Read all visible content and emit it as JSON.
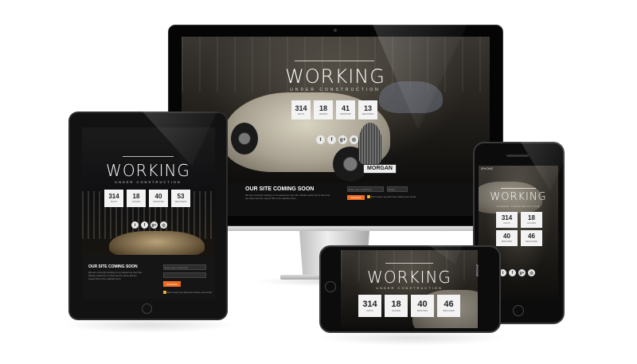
{
  "site": {
    "title": "WORKING",
    "subtitle": "UNDER CONSTRUCTION",
    "plate": "MORGAN"
  },
  "imac": {
    "countdown": [
      {
        "value": "314",
        "label": "DAYS"
      },
      {
        "value": "18",
        "label": "HOURS"
      },
      {
        "value": "41",
        "label": "MINUTES"
      },
      {
        "value": "13",
        "label": "SECONDS"
      }
    ],
    "coming_soon": "OUR SITE COMING SOON",
    "description": "We are currently working on an awesome new site. Please stand by! In short we are done and we expect this to be realized soon.",
    "email_placeholder": "Enter your email here",
    "name_placeholder": "Name",
    "subscribe": "Subscribe",
    "notice": "Don't worry we will never share your email"
  },
  "ipad": {
    "countdown": [
      {
        "value": "314",
        "label": "DAYS"
      },
      {
        "value": "18",
        "label": "HOURS"
      },
      {
        "value": "40",
        "label": "MINUTES"
      },
      {
        "value": "53",
        "label": "SECONDS"
      }
    ],
    "coming_soon": "OUR SITE COMING SOON",
    "description": "We are currently working on an awesome new site. Please stand by! In short we are done and we expect this to be realized soon.",
    "email_placeholder": "Enter your email here",
    "subscribe": "Subscribe",
    "notice": "Don't worry we will never share your email"
  },
  "iphone_portrait": {
    "carrier": "iPHONE",
    "countdown": [
      {
        "value": "314",
        "label": "DAYS"
      },
      {
        "value": "18",
        "label": "HOURS"
      },
      {
        "value": "40",
        "label": "MINUTES"
      },
      {
        "value": "46",
        "label": "SECONDS"
      }
    ]
  },
  "iphone_landscape": {
    "carrier": "iPHONE",
    "countdown": [
      {
        "value": "314",
        "label": "DAYS"
      },
      {
        "value": "18",
        "label": "HOURS"
      },
      {
        "value": "40",
        "label": "MINUTES"
      },
      {
        "value": "46",
        "label": "SECONDS"
      }
    ]
  },
  "social_icons": [
    "twitter-icon",
    "facebook-icon",
    "google-plus-icon",
    "dribbble-icon"
  ],
  "colors": {
    "accent": "#f26b21",
    "notice": "#f2b233",
    "countdown_bg": "#f3f3f3",
    "bezel": "#050505"
  }
}
